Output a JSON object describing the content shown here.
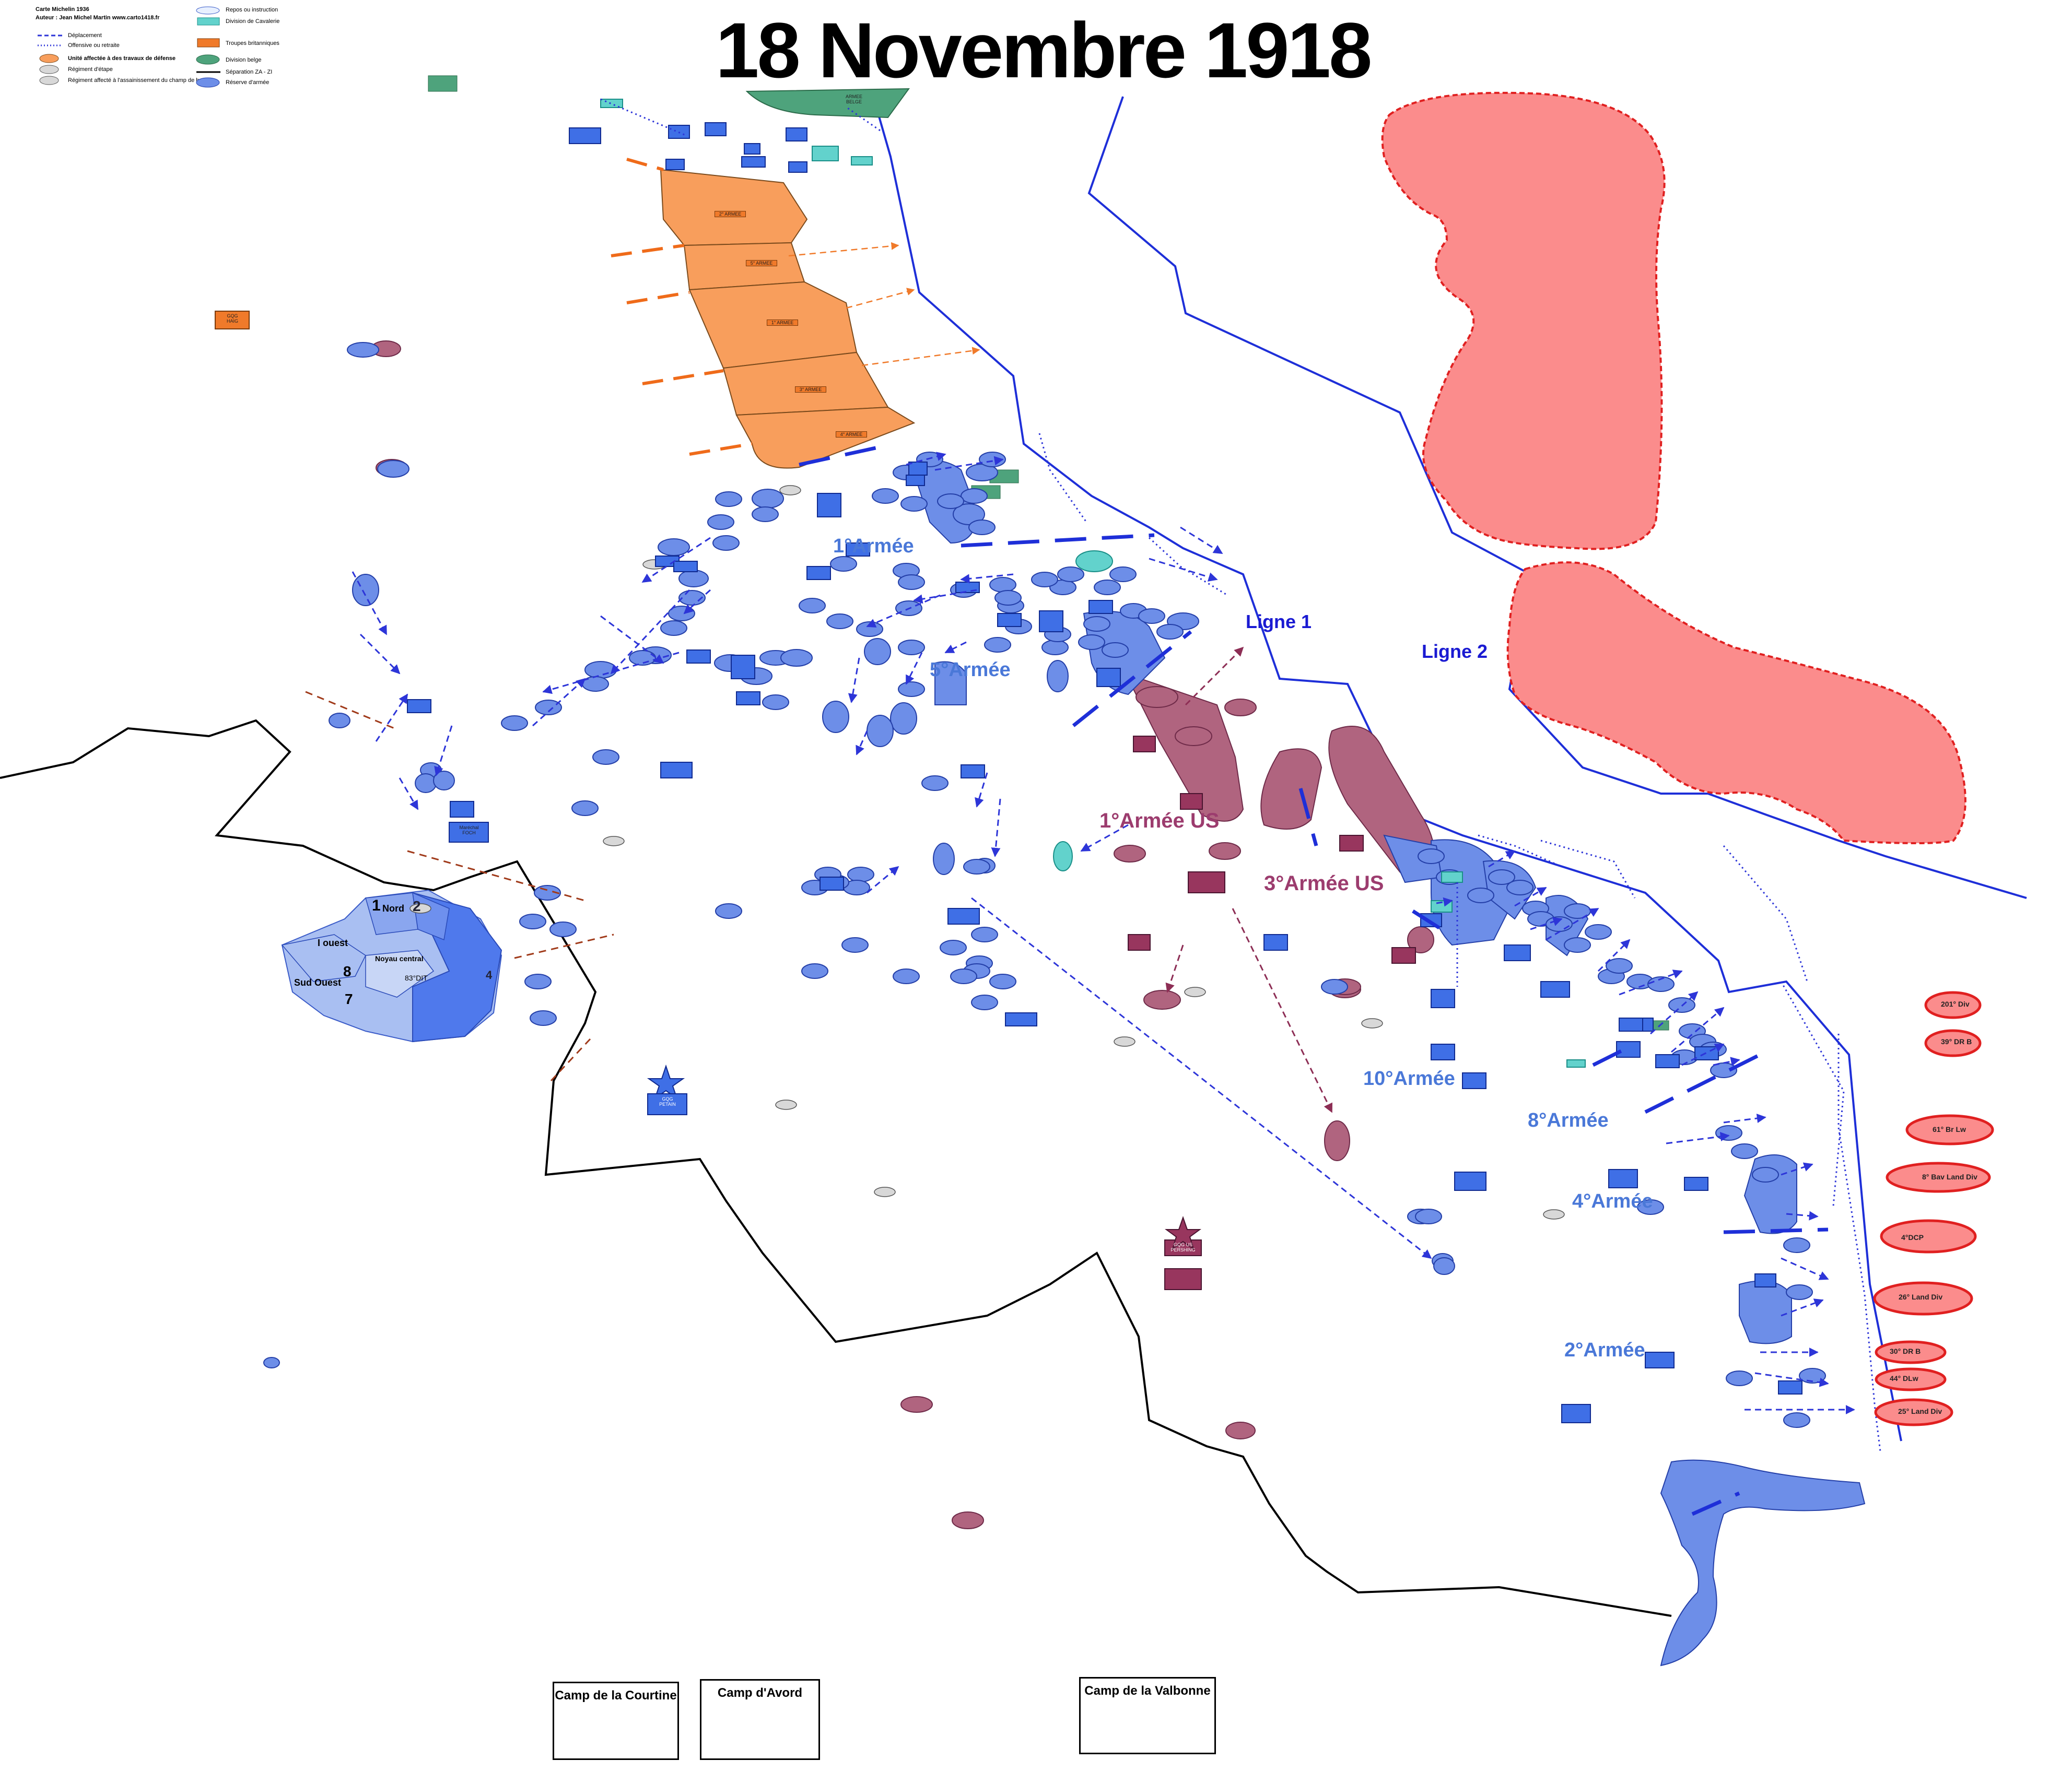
{
  "title": "18 Novembre 1918",
  "credit": {
    "line1": "Carte Michelin 1936",
    "line2": "Auteur : Jean Michel Martin    www.carto1418.fr"
  },
  "legend": {
    "left": [
      {
        "label": "Déplacement",
        "symbol": "dashed-arrow"
      },
      {
        "label": "Offensive ou retraite",
        "symbol": "dotted-arrow"
      },
      {
        "label": "Unité affectée à des travaux de défense",
        "symbol": "orange-oval"
      },
      {
        "label": "Régiment d'étape",
        "symbol": "grey-oval"
      },
      {
        "label": "Régiment affecté à l'assainissement du champ de bataille",
        "symbol": "grey-oval"
      }
    ],
    "right": [
      {
        "label": "Repos ou instruction",
        "symbol": "light-blue-oval"
      },
      {
        "label": "Division de Cavalerie",
        "symbol": "teal-rect",
        "swatch_text": "6° DC"
      },
      {
        "label": "Troupes britanniques",
        "symbol": "orange-rect",
        "swatch_text": "2° CA"
      },
      {
        "label": "Division belge",
        "symbol": "green-oval",
        "swatch_text": "1° DI"
      },
      {
        "label": "Séparation ZA - ZI",
        "symbol": "black-line"
      },
      {
        "label": "Réserve d'armée",
        "symbol": "blue-oval"
      }
    ]
  },
  "army_labels": [
    {
      "text": "1°Armée",
      "group": "french"
    },
    {
      "text": "5°Armée",
      "group": "french"
    },
    {
      "text": "10°Armée",
      "group": "french"
    },
    {
      "text": "8°Armée",
      "group": "french"
    },
    {
      "text": "4°Armée",
      "group": "french"
    },
    {
      "text": "2°Armée",
      "group": "french"
    },
    {
      "text": "1°Armée US",
      "group": "us"
    },
    {
      "text": "3°Armée US",
      "group": "us"
    }
  ],
  "lines": [
    {
      "text": "Ligne 1"
    },
    {
      "text": "Ligne 2"
    }
  ],
  "poche_labels": [
    "1",
    "Nord",
    "2",
    "I ouest",
    "Noyau central",
    "Sud Ouest",
    "8",
    "7",
    "4",
    "83°DIT"
  ],
  "british_armies": [
    "2° ARMEE",
    "5° ARMEE",
    "1° ARMEE",
    "3° ARMEE",
    "4° ARMEE"
  ],
  "headquarters": [
    {
      "label": "GQG",
      "sub": "PETAIN"
    },
    {
      "label": "Maréchal",
      "sub": "FOCH"
    },
    {
      "label": "GQG",
      "sub": "HAIG"
    },
    {
      "label": "GQG US",
      "sub": "PERSHING"
    },
    {
      "label": "ARMEE",
      "sub": "BELGE"
    }
  ],
  "german_divisions": [
    "201° Div",
    "39° DR B",
    "61° Br Lw",
    "8° Bav Land Div",
    "4°DCP",
    "26° Land Div",
    "30° DR B",
    "44° DLw",
    "25° Land Div"
  ],
  "camps": [
    "Camp de la Courtine",
    "Camp d'Avord",
    "Camp de la Valbonne"
  ],
  "colors": {
    "french": "#6d8ee8",
    "french_light": "#a9bff2",
    "french_hq": "#3f6fe6",
    "us": "#b0647f",
    "us_hq": "#98365e",
    "british": "#f89e5c",
    "belgian": "#4ea37c",
    "cavalry": "#62d2cc",
    "german": "#fb8c8c",
    "german_edge": "#e02020",
    "front": "#1e2fd8",
    "label_blue": "#4a78d8",
    "label_maroon": "#9c3c6e"
  }
}
